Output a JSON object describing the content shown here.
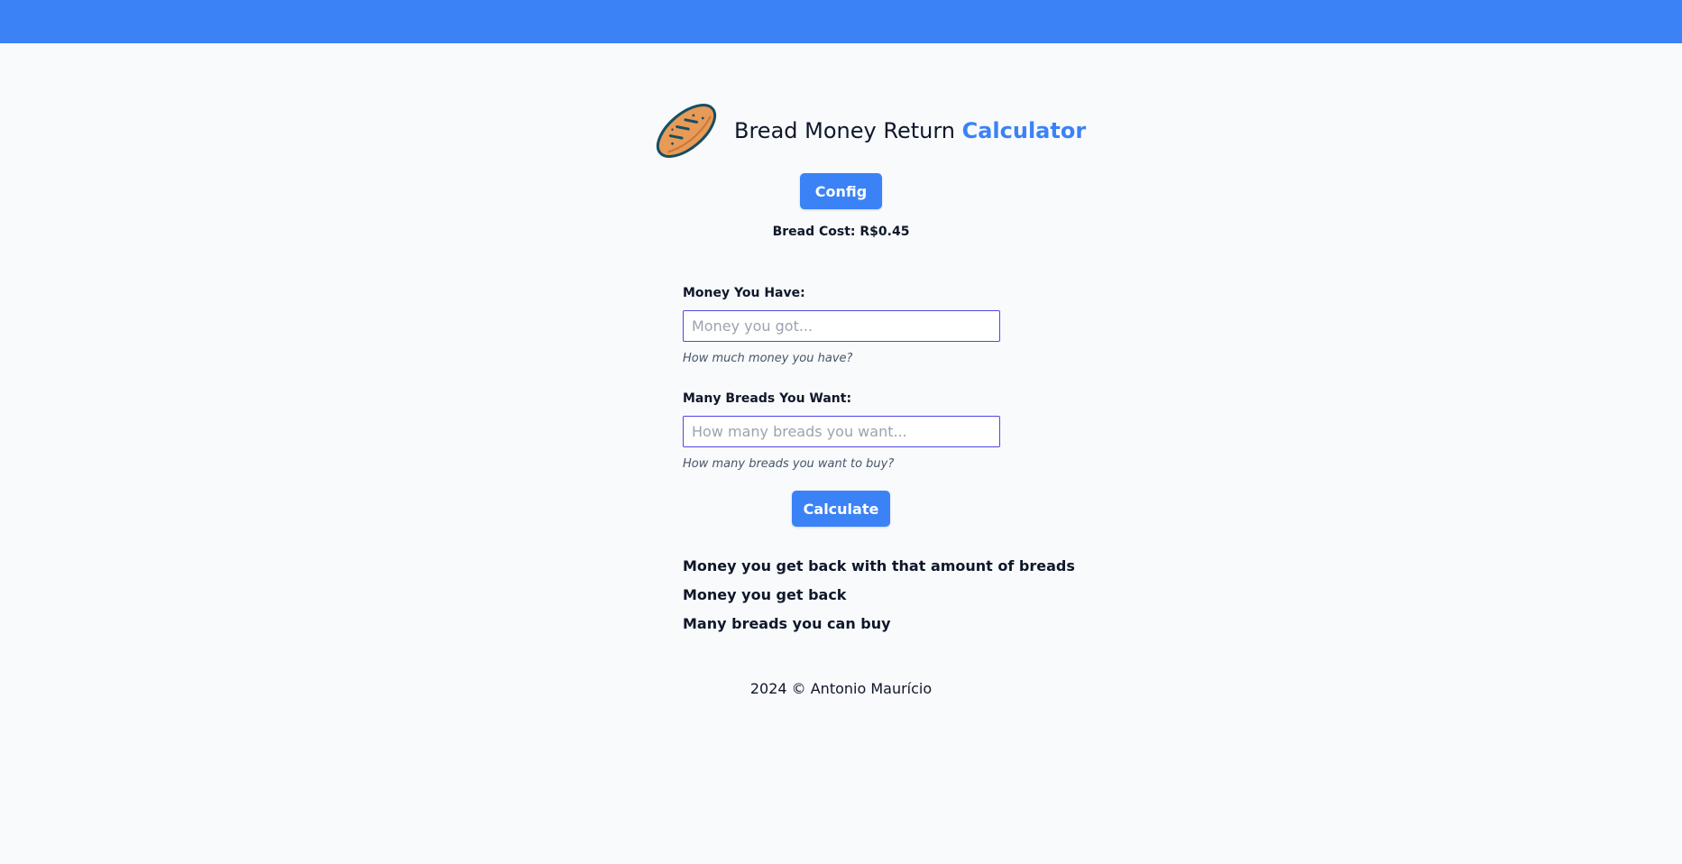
{
  "colors": {
    "primary": "#3b82f6",
    "background": "#f8fafc",
    "input_border": "#4f46e5",
    "bread_fill": "#e89a57",
    "bread_outline": "#164e63"
  },
  "header": {
    "icon": "bread-icon",
    "title_plain": "Bread Money Return ",
    "title_accent": "Calculator"
  },
  "config": {
    "button_label": "Config"
  },
  "bread_cost": {
    "text": "Bread Cost: R$0.45"
  },
  "form": {
    "money": {
      "label": "Money You Have:",
      "placeholder": "Money you got...",
      "value": "",
      "help": "How much money you have?"
    },
    "breads": {
      "label": "Many Breads You Want:",
      "placeholder": "How many breads you want...",
      "value": "",
      "help": "How many breads you want to buy?"
    },
    "calculate_label": "Calculate"
  },
  "results": {
    "back_with_amount": "Money you get back with that amount of breads",
    "money_back": "Money you get back",
    "breads_can_buy": "Many breads you can buy"
  },
  "footer": {
    "text": "2024 © Antonio Maurício"
  }
}
